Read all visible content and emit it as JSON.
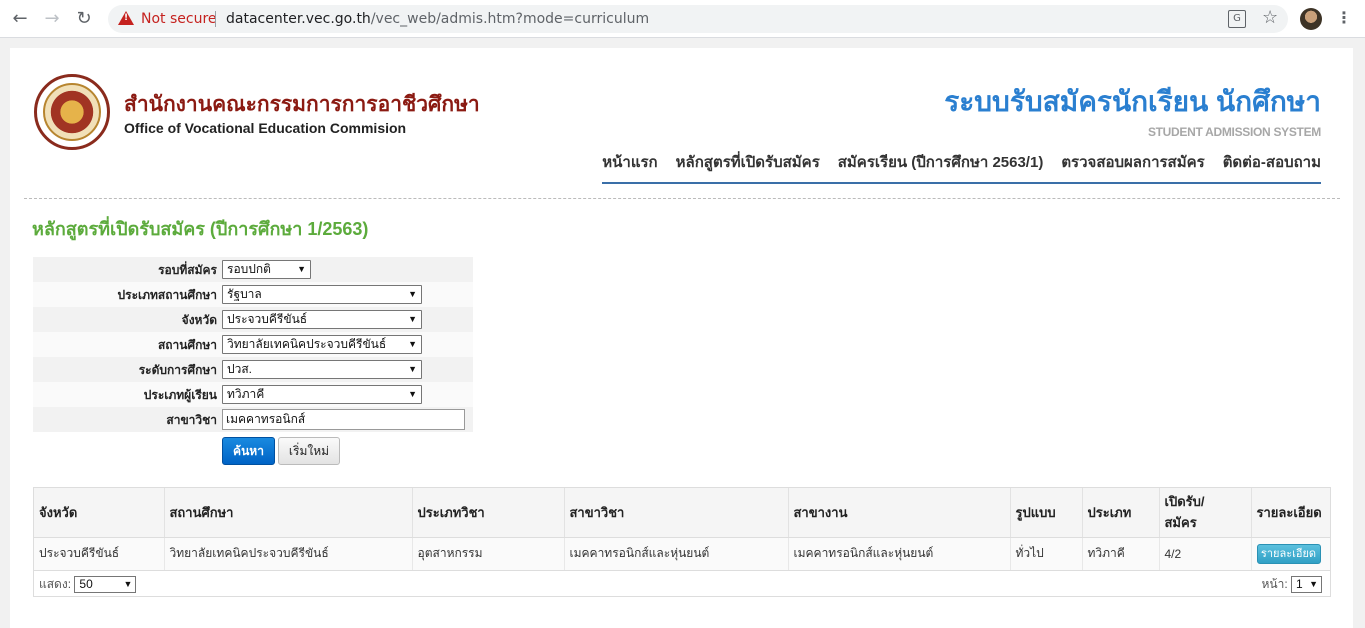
{
  "browser": {
    "security_text": "Not secure",
    "url_host": "datacenter.vec.go.th",
    "url_path": "/vec_web/admis.htm?mode=curriculum"
  },
  "header": {
    "org_name_th": "สำนักงานคณะกรรมการการอาชีวศึกษา",
    "org_name_en": "Office of Vocational Education Commision",
    "system_name_th": "ระบบรับสมัครนักเรียน นักศึกษา",
    "system_name_en": "STUDENT ADMISSION SYSTEM"
  },
  "nav": {
    "items": [
      "หน้าแรก",
      "หลักสูตรที่เปิดรับสมัคร",
      "สมัครเรียน (ปีการศึกษา 2563/1)",
      "ตรวจสอบผลการสมัคร",
      "ติดต่อ-สอบถาม"
    ]
  },
  "page_title": "หลักสูตรที่เปิดรับสมัคร (ปีการศึกษา 1/2563)",
  "form": {
    "round_label": "รอบที่สมัคร",
    "round_value": "รอบปกติ",
    "school_type_label": "ประเภทสถานศึกษา",
    "school_type_value": "รัฐบาล",
    "province_label": "จังหวัด",
    "province_value": "ประจวบคีรีขันธ์",
    "school_label": "สถานศึกษา",
    "school_value": "วิทยาลัยเทคนิคประจวบคีรีขันธ์",
    "level_label": "ระดับการศึกษา",
    "level_value": "ปวส.",
    "learner_type_label": "ประเภทผู้เรียน",
    "learner_type_value": "ทวิภาคี",
    "major_label": "สาขาวิชา",
    "major_value": "เมคคาทรอนิกส์",
    "search_button": "ค้นหา",
    "reset_button": "เริ่มใหม่"
  },
  "table": {
    "headers": [
      "จังหวัด",
      "สถานศึกษา",
      "ประเภทวิชา",
      "สาขาวิชา",
      "สาขางาน",
      "รูปแบบ",
      "ประเภท",
      "เปิดรับ/ สมัคร",
      "รายละเอียด"
    ],
    "rows": [
      [
        "ประจวบคีรีขันธ์",
        "วิทยาลัยเทคนิคประจวบคีรีขันธ์",
        "อุตสาหกรรม",
        "เมคคาทรอนิกส์และหุ่นยนต์",
        "เมคคาทรอนิกส์และหุ่นยนต์",
        "ทั่วไป",
        "ทวิภาคี",
        "4/2",
        "รายละเอียด"
      ]
    ],
    "show_label": "แสดง:",
    "show_value": "50",
    "page_label": "หน้า:",
    "page_value": "1"
  }
}
